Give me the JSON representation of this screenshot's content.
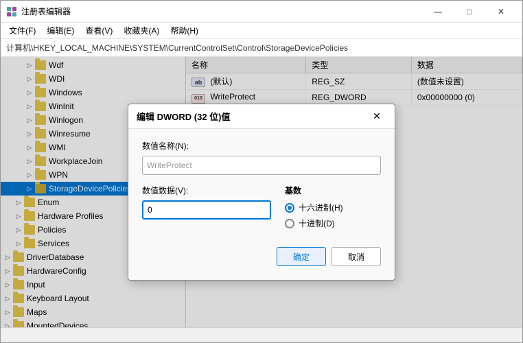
{
  "window": {
    "title": "注册表编辑器",
    "controls": {
      "minimize": "—",
      "maximize": "□",
      "close": "✕"
    }
  },
  "menu": {
    "items": [
      "文件(F)",
      "编辑(E)",
      "查看(V)",
      "收藏夹(A)",
      "帮助(H)"
    ]
  },
  "address": {
    "label": "计算机\\HKEY_LOCAL_MACHINE\\SYSTEM\\CurrentControlSet\\Control\\StorageDevicePolicies"
  },
  "tree": {
    "items": [
      {
        "label": "Wdf",
        "indent": "indent2",
        "expanded": false
      },
      {
        "label": "WDI",
        "indent": "indent2",
        "expanded": false
      },
      {
        "label": "Windows",
        "indent": "indent2",
        "expanded": false
      },
      {
        "label": "WinInit",
        "indent": "indent2",
        "expanded": false
      },
      {
        "label": "Winlogon",
        "indent": "indent2",
        "expanded": false
      },
      {
        "label": "Winresume",
        "indent": "indent2",
        "expanded": false
      },
      {
        "label": "WMI",
        "indent": "indent2",
        "expanded": false
      },
      {
        "label": "WorkplaceJoin",
        "indent": "indent2",
        "expanded": false
      },
      {
        "label": "WPN",
        "indent": "indent2",
        "expanded": false
      },
      {
        "label": "StorageDevicePolicies",
        "indent": "indent2",
        "expanded": false,
        "selected": true
      },
      {
        "label": "Enum",
        "indent": "indent1",
        "expanded": false
      },
      {
        "label": "Hardware Profiles",
        "indent": "indent1",
        "expanded": false
      },
      {
        "label": "Policies",
        "indent": "indent1",
        "expanded": false
      },
      {
        "label": "Services",
        "indent": "indent1",
        "expanded": false
      },
      {
        "label": "DriverDatabase",
        "indent": "indent0",
        "expanded": false
      },
      {
        "label": "HardwareConfig",
        "indent": "indent0",
        "expanded": false
      },
      {
        "label": "Input",
        "indent": "indent0",
        "expanded": false
      },
      {
        "label": "Keyboard Layout",
        "indent": "indent0",
        "expanded": false
      },
      {
        "label": "Maps",
        "indent": "indent0",
        "expanded": false
      },
      {
        "label": "MountedDevices",
        "indent": "indent0",
        "expanded": false
      }
    ]
  },
  "registry_table": {
    "columns": [
      "名称",
      "类型",
      "数据"
    ],
    "rows": [
      {
        "name": "(默认)",
        "type": "REG_SZ",
        "data": "(数值未设置)",
        "icon": "ab"
      },
      {
        "name": "WriteProtect",
        "type": "REG_DWORD",
        "data": "0x00000000 (0)",
        "icon": "dword"
      }
    ]
  },
  "dialog": {
    "title": "编辑 DWORD (32 位)值",
    "name_label": "数值名称(N):",
    "name_value": "WriteProtect",
    "data_label": "数值数据(V):",
    "data_value": "0",
    "base_label": "基数",
    "radios": [
      {
        "label": "十六进制(H)",
        "checked": true
      },
      {
        "label": "十进制(D)",
        "checked": false
      }
    ],
    "ok_label": "确定",
    "cancel_label": "取消"
  }
}
